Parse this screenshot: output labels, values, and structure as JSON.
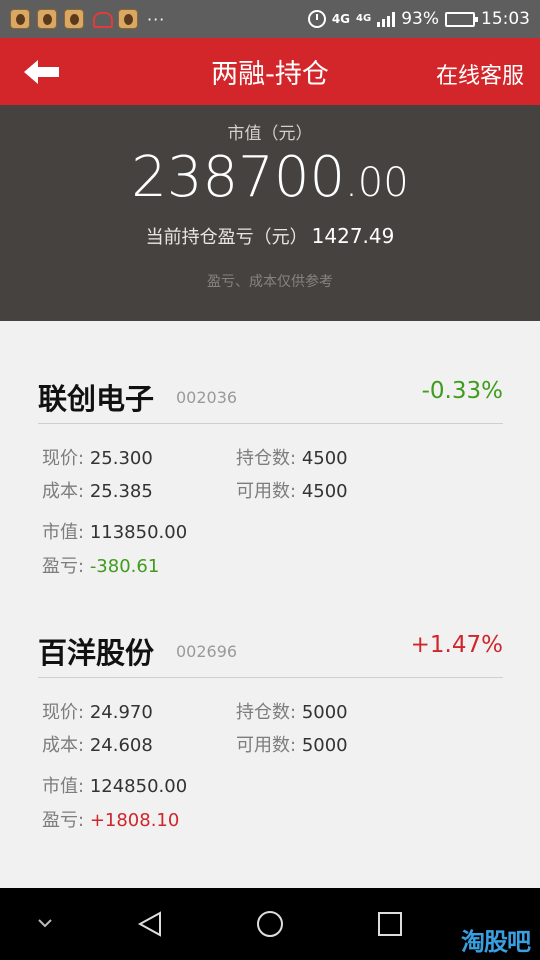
{
  "status_bar": {
    "more": "···",
    "network": "4G",
    "network2": "4G",
    "battery": "93%",
    "battery_level": 0.93,
    "time": "15:03"
  },
  "header": {
    "title": "两融-持仓",
    "service": "在线客服"
  },
  "summary": {
    "market_value_label": "市值（元）",
    "market_value_int": "238700",
    "market_value_dec": ".00",
    "pnl_label": "当前持仓盈亏（元）",
    "pnl_value": "1427.49",
    "disclaimer": "盈亏、成本仅供参考"
  },
  "labels": {
    "price": "现价:",
    "cost": "成本:",
    "position": "持仓数:",
    "available": "可用数:",
    "market_value": "市值:",
    "pnl": "盈亏:"
  },
  "stocks": [
    {
      "name": "联创电子",
      "code": "002036",
      "change": "-0.33%",
      "price": "25.300",
      "cost": "25.385",
      "position": "4500",
      "available": "4500",
      "market_value": "113850.00",
      "pnl": "-380.61"
    },
    {
      "name": "百洋股份",
      "code": "002696",
      "change": "+1.47%",
      "price": "24.970",
      "cost": "24.608",
      "position": "5000",
      "available": "5000",
      "market_value": "124850.00",
      "pnl": "+1808.10"
    }
  ],
  "watermark": "淘股吧",
  "colors": {
    "header": "#d3262b",
    "summary_bg": "#46423f",
    "down": "#3f9c1e",
    "up": "#d0262b"
  }
}
